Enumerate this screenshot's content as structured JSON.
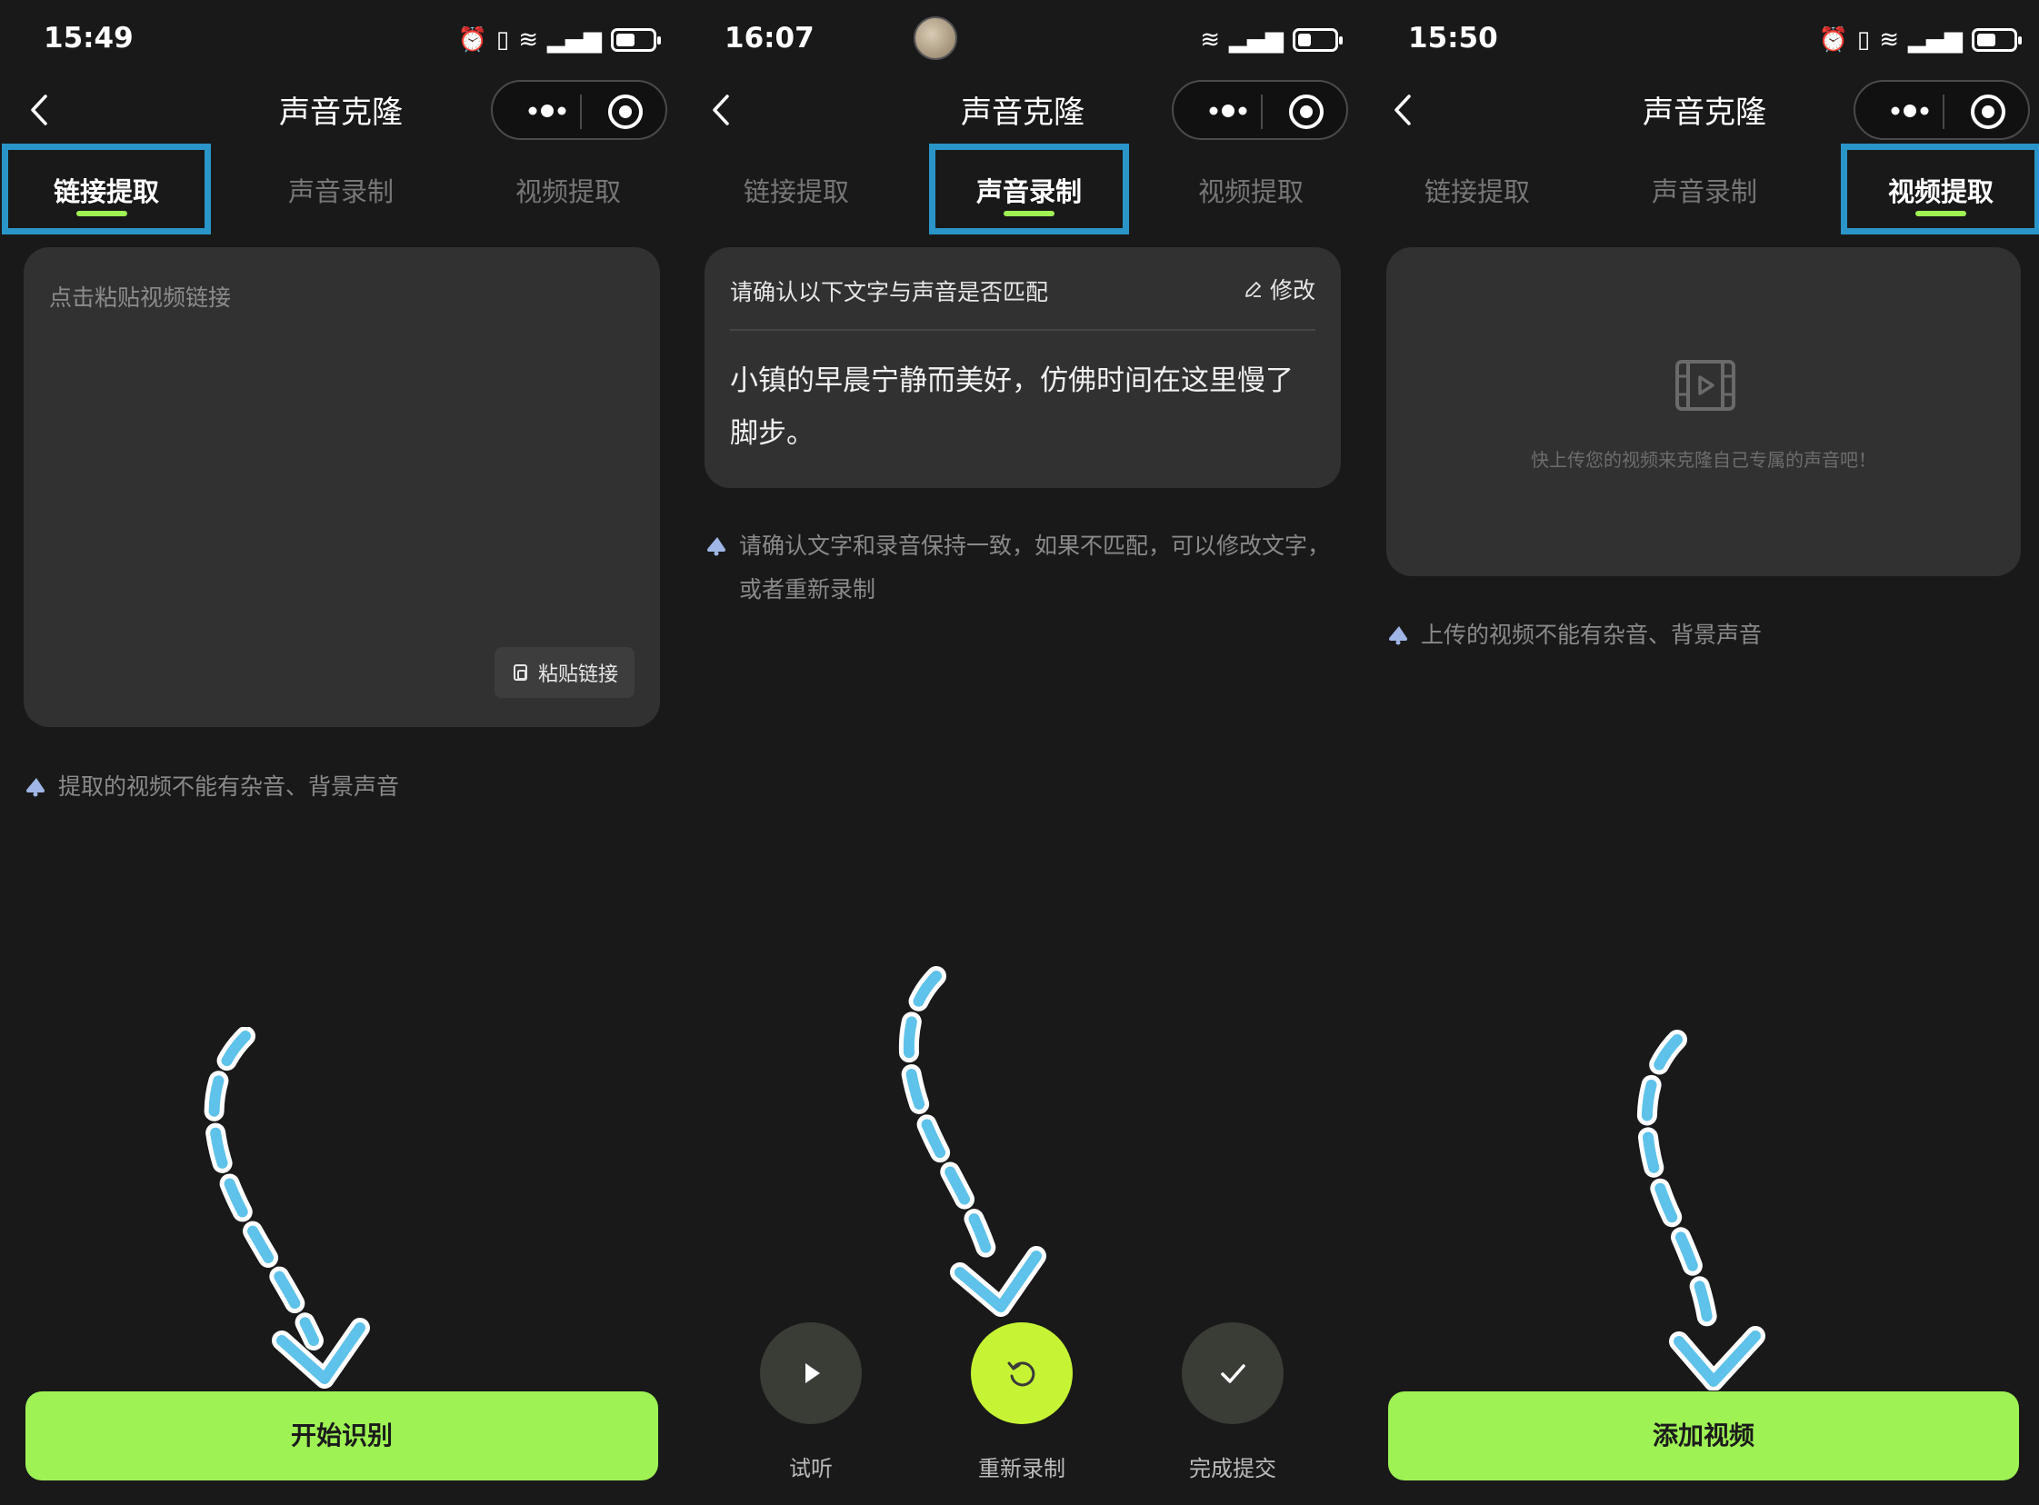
{
  "screens": [
    {
      "status_time": "15:49",
      "nav_title": "声音克隆",
      "tabs": [
        "链接提取",
        "声音录制",
        "视频提取"
      ],
      "active_tab": "链接提取",
      "link_input_placeholder": "点击粘贴视频链接",
      "paste_button": "粘贴链接",
      "tip": "提取的视频不能有杂音、背景声音",
      "primary_button": "开始识别"
    },
    {
      "status_time": "16:07",
      "nav_title": "声音克隆",
      "tabs": [
        "链接提取",
        "声音录制",
        "视频提取"
      ],
      "active_tab": "声音录制",
      "confirm_question": "请确认以下文字与声音是否匹配",
      "edit_button": "修改",
      "script_text": "小镇的早晨宁静而美好，仿佛时间在这里慢了脚步。",
      "tip": "请确认文字和录音保持一致，如果不匹配，可以修改文字，或者重新录制",
      "controls": [
        {
          "label": "试听",
          "icon": "play-icon"
        },
        {
          "label": "重新录制",
          "icon": "rerecord-icon"
        },
        {
          "label": "完成提交",
          "icon": "check-icon"
        }
      ]
    },
    {
      "status_time": "15:50",
      "nav_title": "声音克隆",
      "tabs": [
        "链接提取",
        "声音录制",
        "视频提取"
      ],
      "active_tab": "视频提取",
      "upload_hint": "快上传您的视频来克隆自己专属的声音吧！",
      "tip": "上传的视频不能有杂音、背景声音",
      "primary_button": "添加视频"
    }
  ],
  "colors": {
    "accent_green": "#9ef254",
    "record_button": "#c6f435",
    "highlight_frame": "#2a95c8",
    "annotation_arrow": "#5ec2ea",
    "background": "#191919",
    "card": "#313131"
  }
}
